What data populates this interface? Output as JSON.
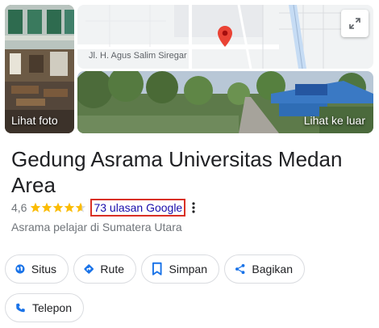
{
  "media": {
    "photos_label": "Lihat foto",
    "street_view_label": "Lihat ke luar",
    "map_street_label": "Jl. H. Agus Salim Siregar"
  },
  "place": {
    "title": "Gedung Asrama Universitas Medan Area",
    "rating": "4,6",
    "stars": 4.6,
    "reviews": "73 ulasan Google",
    "category": "Asrama pelajar di Sumatera Utara"
  },
  "actions": {
    "situs": "Situs",
    "rute": "Rute",
    "simpan": "Simpan",
    "bagikan": "Bagikan",
    "telepon": "Telepon"
  },
  "colors": {
    "accent": "#1a73e8",
    "star": "#fbbc04",
    "highlight": "#d93025",
    "link": "#1a0dab"
  }
}
